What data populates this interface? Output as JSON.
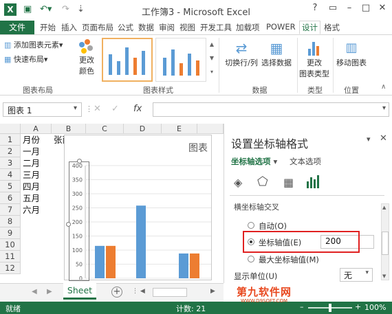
{
  "window": {
    "title": "工作簿3 - Microsoft Excel",
    "help": "?"
  },
  "tabs": [
    "文件",
    "开始",
    "插入",
    "页面布局",
    "公式",
    "数据",
    "审阅",
    "视图",
    "开发工具",
    "加载项",
    "POWER",
    "设计",
    "格式"
  ],
  "active_tab": "设计",
  "ribbon": {
    "add_element": "添加图表元素",
    "quick_layout": "快速布局",
    "change_colors_1": "更改",
    "change_colors_2": "颜色",
    "switch_rowcol": "切换行/列",
    "select_data": "选择数据",
    "change_type_1": "更改",
    "change_type_2": "图表类型",
    "move_chart": "移动图表",
    "groups": {
      "layout": "图表布局",
      "styles": "图表样式",
      "data": "数据",
      "type": "类型",
      "location": "位置"
    }
  },
  "formula_bar": {
    "name_box": "图表 1",
    "fx": "fx",
    "value": ""
  },
  "columns": [
    "A",
    "B",
    "C",
    "D",
    "E"
  ],
  "rows": [
    "1",
    "2",
    "3",
    "4",
    "5",
    "6",
    "7",
    "8",
    "9",
    "10",
    "11",
    "12"
  ],
  "cells": {
    "A1": "月份",
    "B1": "张丽",
    "A2": "一月",
    "A3": "二月",
    "A4": "三月",
    "A5": "四月",
    "A6": "五月",
    "A7": "六月"
  },
  "chart": {
    "title": "图表",
    "y_ticks": [
      "400",
      "350",
      "300",
      "250",
      "200",
      "150",
      "100",
      "50",
      "0"
    ],
    "colors": {
      "blue": "#5b9bd5",
      "orange": "#ed7d31"
    }
  },
  "chart_data": {
    "type": "bar",
    "ylim": [
      0,
      400
    ],
    "groups_visible": 3,
    "series": [
      {
        "color": "#5b9bd5",
        "values": [
          115,
          258,
          88
        ]
      },
      {
        "color": "#ed7d31",
        "values": [
          115,
          null,
          88
        ]
      }
    ]
  },
  "pane": {
    "title": "设置坐标轴格式",
    "tab_axis": "坐标轴选项",
    "tab_text": "文本选项",
    "section": "横坐标轴交叉",
    "opt_auto": "自动(O)",
    "opt_value": "坐标轴值(E)",
    "opt_value_input": "200",
    "opt_max": "最大坐标轴值(M)",
    "display_units": "显示单位(U)",
    "display_units_value": "无"
  },
  "sheet": {
    "tab": "Sheet",
    "add": "+"
  },
  "status": {
    "ready": "就绪",
    "count": "计数: 21",
    "zoom": "100%"
  },
  "watermark": {
    "main": "第九软件网",
    "sub": "WWW.D9SOFT.COM"
  },
  "accent": "#217346",
  "highlight": "#e02020"
}
